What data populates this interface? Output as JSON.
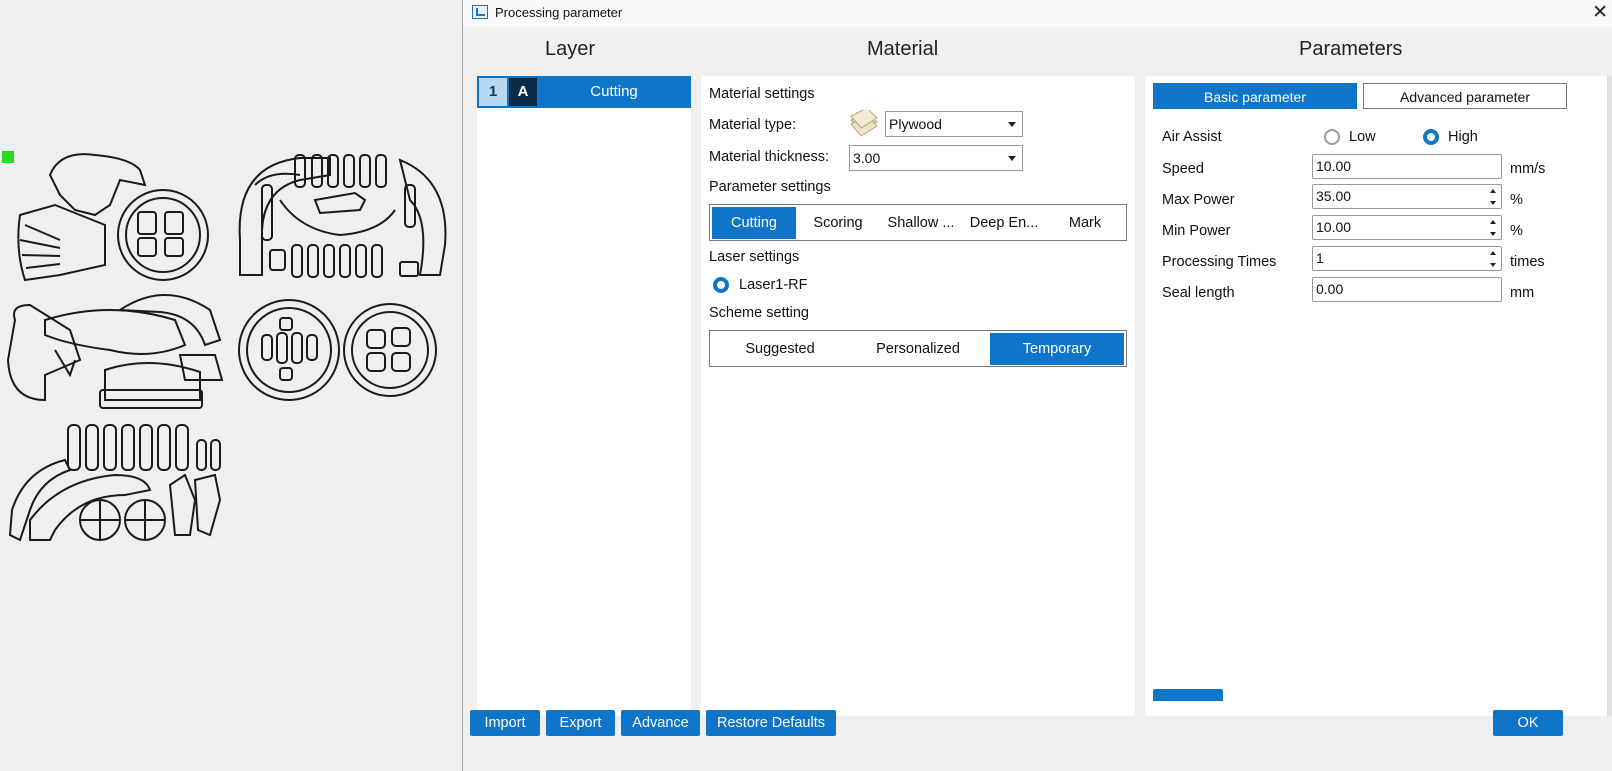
{
  "window": {
    "title": "Processing parameter",
    "close_glyph": "✕"
  },
  "headers": {
    "layer": "Layer",
    "material": "Material",
    "parameters": "Parameters"
  },
  "layer": {
    "number": "1",
    "mode": "A",
    "name": "Cutting"
  },
  "material": {
    "settings_title": "Material settings",
    "type_label": "Material type:",
    "type_value": "Plywood",
    "type_icon": "plywood-icon",
    "thickness_label": "Material thickness:",
    "thickness_value": "3.00",
    "param_settings_title": "Parameter settings",
    "param_tabs": [
      "Cutting",
      "Scoring",
      "Shallow ...",
      "Deep En...",
      "Mark"
    ],
    "param_active": "Cutting",
    "laser_title": "Laser settings",
    "laser_option": "Laser1-RF",
    "scheme_title": "Scheme setting",
    "scheme_tabs": [
      "Suggested",
      "Personalized",
      "Temporary"
    ],
    "scheme_active": "Temporary"
  },
  "parameters": {
    "tabs": {
      "basic": "Basic parameter",
      "advanced": "Advanced parameter"
    },
    "active_tab": "Basic parameter",
    "air_assist": {
      "label": "Air Assist",
      "low": "Low",
      "high": "High",
      "selected": "High"
    },
    "rows": [
      {
        "label": "Speed",
        "value": "10.00",
        "unit": "mm/s"
      },
      {
        "label": "Max Power",
        "value": "35.00",
        "unit": "%"
      },
      {
        "label": "Min Power",
        "value": "10.00",
        "unit": "%"
      },
      {
        "label": "Processing Times",
        "value": "1",
        "unit": "times"
      },
      {
        "label": "Seal length",
        "value": "0.00",
        "unit": "mm"
      }
    ]
  },
  "buttons": {
    "import": "Import",
    "export": "Export",
    "advance": "Advance",
    "restore": "Restore Defaults",
    "ok": "OK"
  },
  "colors": {
    "accent": "#0f75c9",
    "selection_marker": "#22dd22"
  }
}
